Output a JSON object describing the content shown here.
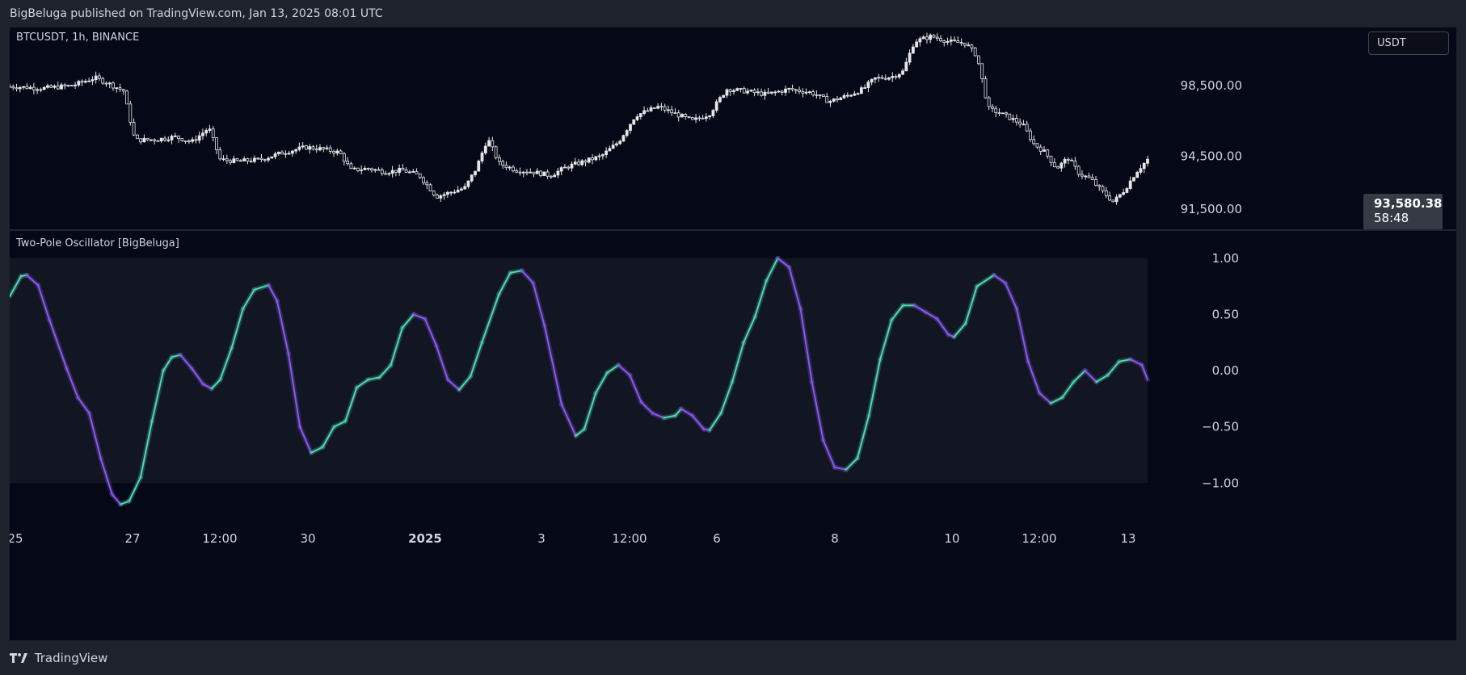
{
  "header": {
    "published_by": "BigBeluga published on TradingView.com, Jan 13, 2025 08:01 UTC"
  },
  "footer": {
    "brand": "TradingView"
  },
  "colors": {
    "background": "#050816",
    "frame": "#1e222d",
    "candle": "#e6e6e6",
    "osc_up": "#4fd8b2",
    "osc_down": "#8a58ef",
    "osc_band": "#121623"
  },
  "icons": {
    "logo": "tradingview-logo-icon"
  },
  "chart_data": [
    {
      "type": "candlestick",
      "symbol_label": "BTCUSDT, 1h, BINANCE",
      "currency": "USDT",
      "last_price": "93,580.38",
      "countdown": "58:48",
      "ylim": [
        90300,
        101800
      ],
      "yticks": [
        {
          "value": 98500,
          "label": "98,500.00"
        },
        {
          "value": 94500,
          "label": "94,500.00"
        },
        {
          "value": 91500,
          "label": "91,500.00"
        }
      ],
      "x_domain": [
        0,
        400
      ],
      "close_path": [
        {
          "x": 0,
          "y": 98450
        },
        {
          "x": 12,
          "y": 98350
        },
        {
          "x": 22,
          "y": 98500
        },
        {
          "x": 30,
          "y": 98950
        },
        {
          "x": 35,
          "y": 98600
        },
        {
          "x": 40,
          "y": 98200
        },
        {
          "x": 44,
          "y": 95400
        },
        {
          "x": 52,
          "y": 95450
        },
        {
          "x": 58,
          "y": 95600
        },
        {
          "x": 64,
          "y": 95300
        },
        {
          "x": 70,
          "y": 96100
        },
        {
          "x": 74,
          "y": 94300
        },
        {
          "x": 80,
          "y": 94200
        },
        {
          "x": 88,
          "y": 94300
        },
        {
          "x": 96,
          "y": 94700
        },
        {
          "x": 104,
          "y": 95000
        },
        {
          "x": 110,
          "y": 94900
        },
        {
          "x": 116,
          "y": 94700
        },
        {
          "x": 120,
          "y": 93700
        },
        {
          "x": 126,
          "y": 93800
        },
        {
          "x": 132,
          "y": 93600
        },
        {
          "x": 138,
          "y": 93700
        },
        {
          "x": 144,
          "y": 93400
        },
        {
          "x": 150,
          "y": 92200
        },
        {
          "x": 154,
          "y": 92400
        },
        {
          "x": 160,
          "y": 92700
        },
        {
          "x": 164,
          "y": 93800
        },
        {
          "x": 168,
          "y": 95500
        },
        {
          "x": 172,
          "y": 94100
        },
        {
          "x": 178,
          "y": 93700
        },
        {
          "x": 184,
          "y": 93600
        },
        {
          "x": 190,
          "y": 93400
        },
        {
          "x": 196,
          "y": 93900
        },
        {
          "x": 202,
          "y": 94200
        },
        {
          "x": 208,
          "y": 94500
        },
        {
          "x": 214,
          "y": 95300
        },
        {
          "x": 220,
          "y": 96800
        },
        {
          "x": 228,
          "y": 97300
        },
        {
          "x": 234,
          "y": 96900
        },
        {
          "x": 240,
          "y": 96500
        },
        {
          "x": 246,
          "y": 96900
        },
        {
          "x": 252,
          "y": 98300
        },
        {
          "x": 258,
          "y": 98200
        },
        {
          "x": 266,
          "y": 98000
        },
        {
          "x": 274,
          "y": 98300
        },
        {
          "x": 282,
          "y": 98100
        },
        {
          "x": 288,
          "y": 97600
        },
        {
          "x": 294,
          "y": 97900
        },
        {
          "x": 300,
          "y": 98300
        },
        {
          "x": 304,
          "y": 98900
        },
        {
          "x": 310,
          "y": 99000
        },
        {
          "x": 314,
          "y": 99300
        },
        {
          "x": 318,
          "y": 101000
        },
        {
          "x": 324,
          "y": 101300
        },
        {
          "x": 330,
          "y": 101000
        },
        {
          "x": 336,
          "y": 100900
        },
        {
          "x": 340,
          "y": 100200
        },
        {
          "x": 344,
          "y": 97200
        },
        {
          "x": 350,
          "y": 96800
        },
        {
          "x": 356,
          "y": 96300
        },
        {
          "x": 360,
          "y": 95200
        },
        {
          "x": 364,
          "y": 94700
        },
        {
          "x": 368,
          "y": 93800
        },
        {
          "x": 372,
          "y": 94400
        },
        {
          "x": 376,
          "y": 93500
        },
        {
          "x": 380,
          "y": 93200
        },
        {
          "x": 384,
          "y": 92500
        },
        {
          "x": 388,
          "y": 91900
        },
        {
          "x": 392,
          "y": 92600
        },
        {
          "x": 396,
          "y": 93600
        },
        {
          "x": 400,
          "y": 94300
        }
      ],
      "x_ticks": [
        {
          "label": "25",
          "bold": false
        },
        {
          "label": "27",
          "bold": false
        },
        {
          "label": "12:00",
          "bold": false
        },
        {
          "label": "30",
          "bold": false
        },
        {
          "label": "2025",
          "bold": true
        },
        {
          "label": "3",
          "bold": false
        },
        {
          "label": "12:00",
          "bold": false
        },
        {
          "label": "6",
          "bold": false
        },
        {
          "label": "8",
          "bold": false
        },
        {
          "label": "10",
          "bold": false
        },
        {
          "label": "12:00",
          "bold": false
        },
        {
          "label": "13",
          "bold": false
        }
      ]
    },
    {
      "type": "line",
      "title": "Two-Pole Oscillator [BigBeluga]",
      "ylim": [
        -1.35,
        1.25
      ],
      "yticks": [
        {
          "value": 1.0,
          "label": "1.00"
        },
        {
          "value": 0.5,
          "label": "0.50"
        },
        {
          "value": 0.0,
          "label": "0.00"
        },
        {
          "value": -0.5,
          "label": "−0.50"
        },
        {
          "value": -1.0,
          "label": "−1.00"
        }
      ],
      "band": [
        -1.0,
        1.0
      ],
      "series": [
        {
          "values": [
            {
              "x": 0,
              "y": 0.66
            },
            {
              "x": 4,
              "y": 0.84
            },
            {
              "x": 6,
              "y": 0.85
            },
            {
              "x": 10,
              "y": 0.76
            },
            {
              "x": 14,
              "y": 0.45
            },
            {
              "x": 20,
              "y": 0.02
            },
            {
              "x": 24,
              "y": -0.24
            },
            {
              "x": 28,
              "y": -0.38
            },
            {
              "x": 32,
              "y": -0.78
            },
            {
              "x": 36,
              "y": -1.1
            },
            {
              "x": 39,
              "y": -1.19
            },
            {
              "x": 42,
              "y": -1.16
            },
            {
              "x": 46,
              "y": -0.95
            },
            {
              "x": 50,
              "y": -0.45
            },
            {
              "x": 54,
              "y": 0.0
            },
            {
              "x": 57,
              "y": 0.12
            },
            {
              "x": 60,
              "y": 0.14
            },
            {
              "x": 64,
              "y": 0.02
            },
            {
              "x": 68,
              "y": -0.12
            },
            {
              "x": 71,
              "y": -0.16
            },
            {
              "x": 74,
              "y": -0.08
            },
            {
              "x": 78,
              "y": 0.2
            },
            {
              "x": 82,
              "y": 0.55
            },
            {
              "x": 86,
              "y": 0.72
            },
            {
              "x": 91,
              "y": 0.76
            },
            {
              "x": 94,
              "y": 0.62
            },
            {
              "x": 98,
              "y": 0.15
            },
            {
              "x": 102,
              "y": -0.5
            },
            {
              "x": 106,
              "y": -0.73
            },
            {
              "x": 110,
              "y": -0.68
            },
            {
              "x": 114,
              "y": -0.5
            },
            {
              "x": 118,
              "y": -0.45
            },
            {
              "x": 122,
              "y": -0.15
            },
            {
              "x": 126,
              "y": -0.08
            },
            {
              "x": 130,
              "y": -0.06
            },
            {
              "x": 134,
              "y": 0.05
            },
            {
              "x": 138,
              "y": 0.38
            },
            {
              "x": 142,
              "y": 0.5
            },
            {
              "x": 146,
              "y": 0.46
            },
            {
              "x": 150,
              "y": 0.22
            },
            {
              "x": 154,
              "y": -0.08
            },
            {
              "x": 158,
              "y": -0.17
            },
            {
              "x": 162,
              "y": -0.05
            },
            {
              "x": 166,
              "y": 0.25
            },
            {
              "x": 172,
              "y": 0.68
            },
            {
              "x": 176,
              "y": 0.87
            },
            {
              "x": 180,
              "y": 0.89
            },
            {
              "x": 184,
              "y": 0.78
            },
            {
              "x": 188,
              "y": 0.4
            },
            {
              "x": 194,
              "y": -0.3
            },
            {
              "x": 199,
              "y": -0.58
            },
            {
              "x": 202,
              "y": -0.52
            },
            {
              "x": 206,
              "y": -0.2
            },
            {
              "x": 210,
              "y": -0.02
            },
            {
              "x": 214,
              "y": 0.05
            },
            {
              "x": 218,
              "y": -0.04
            },
            {
              "x": 222,
              "y": -0.28
            },
            {
              "x": 226,
              "y": -0.38
            },
            {
              "x": 230,
              "y": -0.42
            },
            {
              "x": 234,
              "y": -0.4
            },
            {
              "x": 236,
              "y": -0.34
            },
            {
              "x": 240,
              "y": -0.4
            },
            {
              "x": 244,
              "y": -0.52
            },
            {
              "x": 246,
              "y": -0.53
            },
            {
              "x": 250,
              "y": -0.38
            },
            {
              "x": 254,
              "y": -0.1
            },
            {
              "x": 258,
              "y": 0.25
            },
            {
              "x": 262,
              "y": 0.48
            },
            {
              "x": 266,
              "y": 0.8
            },
            {
              "x": 270,
              "y": 1.0
            },
            {
              "x": 274,
              "y": 0.92
            },
            {
              "x": 278,
              "y": 0.55
            },
            {
              "x": 282,
              "y": -0.1
            },
            {
              "x": 286,
              "y": -0.62
            },
            {
              "x": 290,
              "y": -0.86
            },
            {
              "x": 294,
              "y": -0.88
            },
            {
              "x": 298,
              "y": -0.78
            },
            {
              "x": 302,
              "y": -0.4
            },
            {
              "x": 306,
              "y": 0.1
            },
            {
              "x": 310,
              "y": 0.45
            },
            {
              "x": 314,
              "y": 0.58
            },
            {
              "x": 318,
              "y": 0.58
            },
            {
              "x": 322,
              "y": 0.52
            },
            {
              "x": 326,
              "y": 0.46
            },
            {
              "x": 330,
              "y": 0.32
            },
            {
              "x": 332,
              "y": 0.3
            },
            {
              "x": 336,
              "y": 0.42
            },
            {
              "x": 340,
              "y": 0.75
            },
            {
              "x": 346,
              "y": 0.85
            },
            {
              "x": 350,
              "y": 0.78
            },
            {
              "x": 354,
              "y": 0.55
            },
            {
              "x": 358,
              "y": 0.08
            },
            {
              "x": 362,
              "y": -0.2
            },
            {
              "x": 366,
              "y": -0.29
            },
            {
              "x": 370,
              "y": -0.24
            },
            {
              "x": 374,
              "y": -0.1
            },
            {
              "x": 378,
              "y": 0.0
            },
            {
              "x": 382,
              "y": -0.1
            },
            {
              "x": 386,
              "y": -0.04
            },
            {
              "x": 390,
              "y": 0.08
            },
            {
              "x": 394,
              "y": 0.1
            },
            {
              "x": 398,
              "y": 0.05
            },
            {
              "x": 400,
              "y": -0.08
            }
          ]
        }
      ]
    }
  ]
}
